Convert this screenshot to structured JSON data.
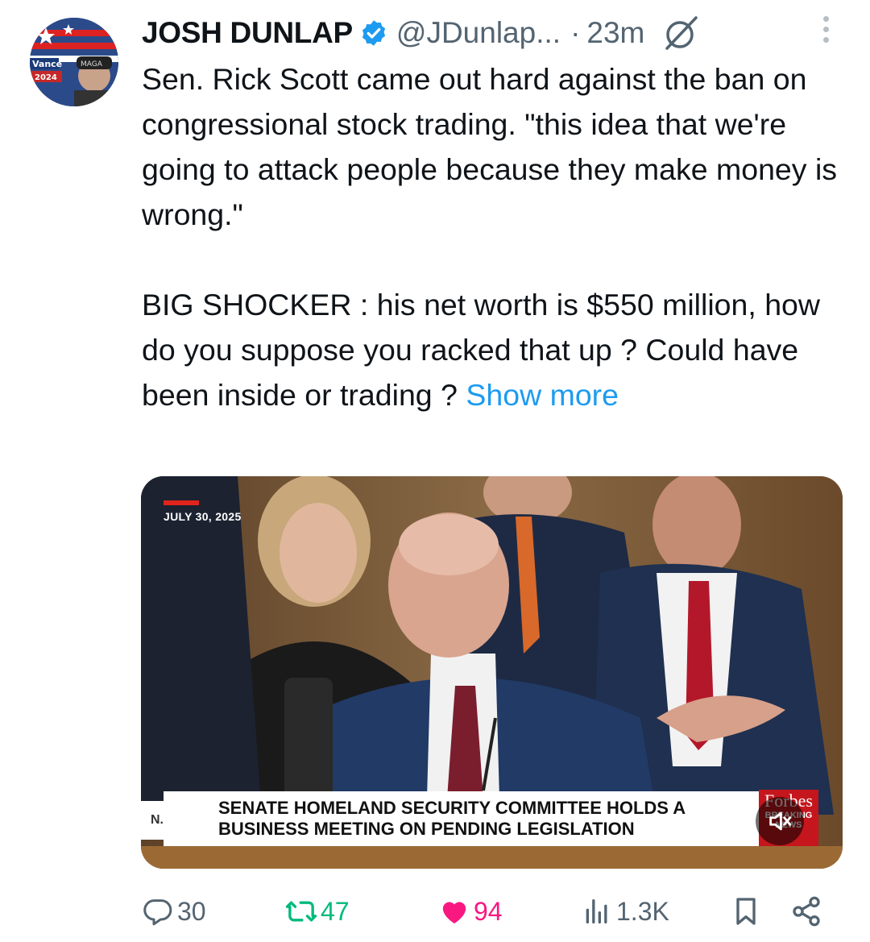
{
  "author": {
    "name": "JOSH DUNLAP",
    "handle": "@JDunlap...",
    "separator": "·",
    "time": "23m",
    "avatar_text": [
      "Vance",
      "2024",
      "MAGA"
    ]
  },
  "tweet": {
    "paragraph1": "Sen. Rick Scott came out hard against the ban on congressional stock trading. \"this idea that we're going to attack people because they make money is wrong.\"",
    "paragraph2": "BIG SHOCKER : his net worth is $550 million, how do you suppose you racked that up ? Could have been inside or trading ?",
    "show_more": "Show more"
  },
  "media": {
    "date": "JULY 30, 2025",
    "chyron_left": "N. H",
    "chyron_line1": "SENATE HOMELAND SECURITY COMMITTEE HOLDS A",
    "chyron_line2": "BUSINESS MEETING ON PENDING LEGISLATION",
    "network_top": "Forbes",
    "network_bottom": "BREAKING NEWS"
  },
  "actions": {
    "replies": "30",
    "reposts": "47",
    "likes": "94",
    "views": "1.3K"
  },
  "colors": {
    "link": "#1d9bf0",
    "repost": "#00ba7c",
    "like": "#f91880",
    "muted": "#536471",
    "verified": "#1d9bf0"
  },
  "icons": [
    "verified-badge-icon",
    "grok-icon",
    "more-icon",
    "reply-icon",
    "repost-icon",
    "like-icon",
    "views-icon",
    "bookmark-icon",
    "share-icon",
    "mute-icon"
  ]
}
